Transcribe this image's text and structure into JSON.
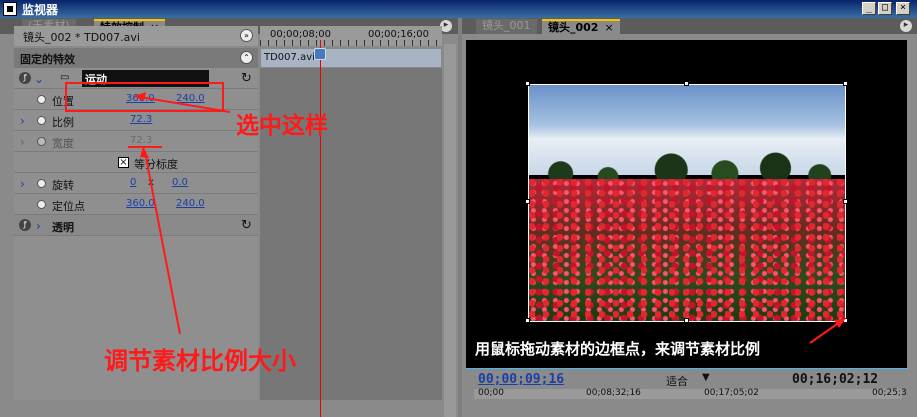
{
  "window": {
    "title": "监视器"
  },
  "left_panel": {
    "tabs": [
      {
        "label": "(无素材)"
      },
      {
        "label": "特效控制"
      }
    ],
    "clip_name": "镜头_002 * TD007.avi",
    "ruler": {
      "tc_start": "00;00;08;00",
      "tc_end": "00;00;16;00"
    },
    "timeline_clip": "TD007.avi",
    "fixed_effects_label": "固定的特效",
    "motion_label": "运动",
    "rows": [
      {
        "label": "位置",
        "v1": "360.0",
        "v2": "240.0"
      },
      {
        "label": "比例",
        "v1": "72.3",
        "v2": ""
      },
      {
        "label": "宽度",
        "v1": "72.3",
        "v2": ""
      },
      {
        "label": "等分标度",
        "v1": "",
        "v2": ""
      },
      {
        "label": "旋转",
        "v1": "0",
        "v2": "0.0",
        "sep": "x"
      },
      {
        "label": "定位点",
        "v1": "360.0",
        "v2": "240.0"
      }
    ],
    "opacity_label": "透明"
  },
  "right_panel": {
    "tabs": [
      {
        "label": "镜头_001"
      },
      {
        "label": "镜头_002"
      }
    ],
    "timecode_current": "00;00;09;16",
    "fit_label": "适合",
    "timecode_duration": "00;16;02;12",
    "scale": [
      "00;00",
      "00;08;32;16",
      "00;17;05;02",
      "00;25;3"
    ]
  },
  "annotations": {
    "select_this": "选中这样",
    "adjust_scale": "调节素材比例大小",
    "drag_hint": "用鼠标拖动素材的边框点，来调节素材比例"
  },
  "colors": {
    "annotation_red": "#ff1a1a",
    "link_blue": "#1a3fa8",
    "accent_blue": "#4ab8f0"
  }
}
